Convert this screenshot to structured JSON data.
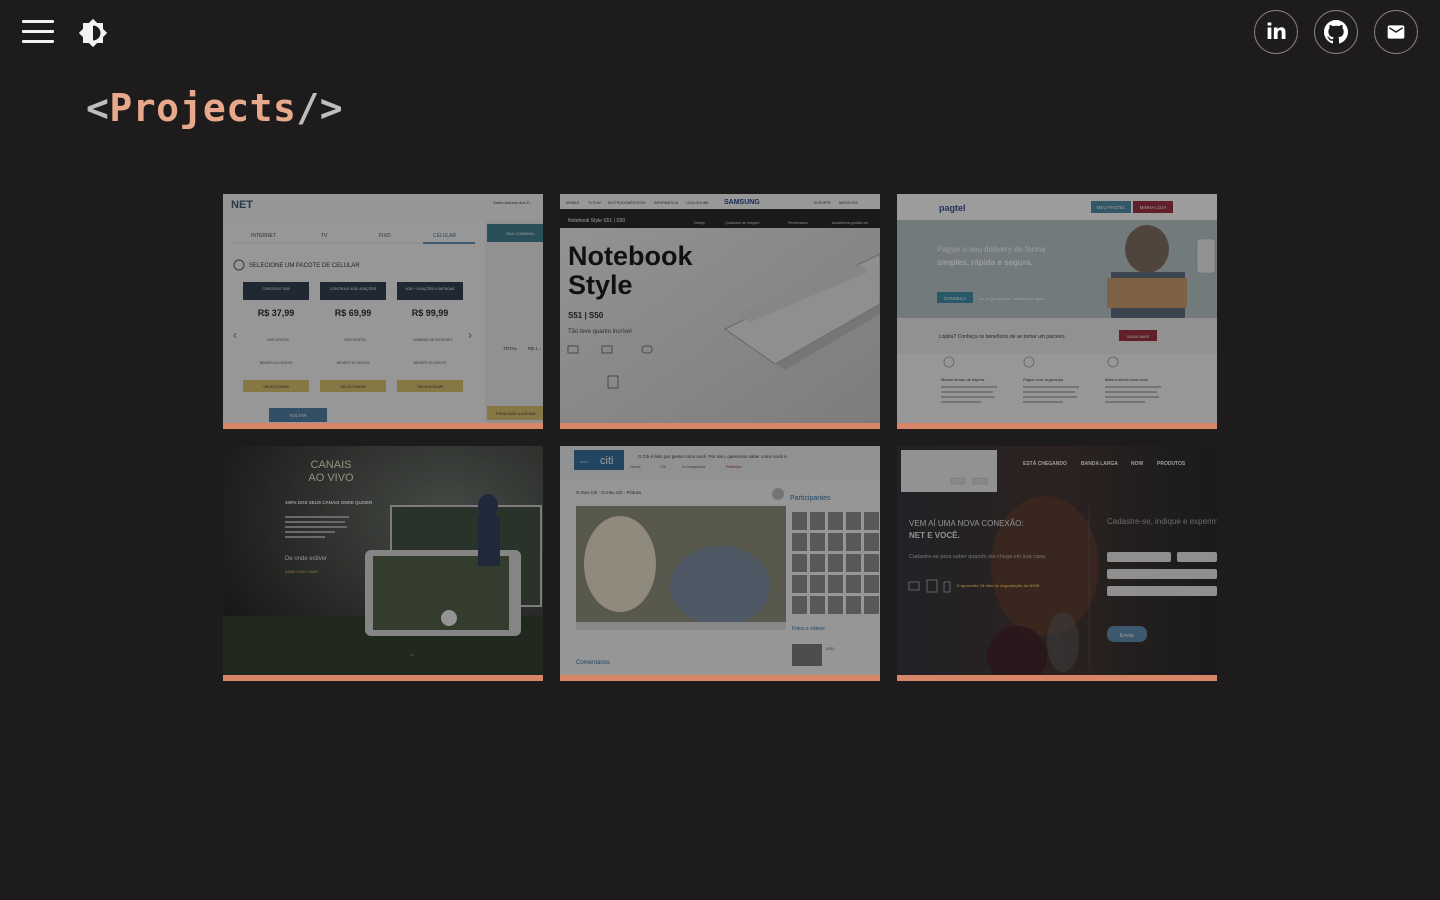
{
  "header": {
    "menu_icon": "hamburger-menu-icon",
    "theme_icon": "brightness-contrast-icon",
    "social": [
      {
        "name": "linkedin",
        "label": "in",
        "icon": "linkedin-icon"
      },
      {
        "name": "github",
        "icon": "github-icon"
      },
      {
        "name": "email",
        "icon": "mail-icon"
      }
    ]
  },
  "page": {
    "title_open": "<",
    "title_text": "Projects",
    "title_close": "/>"
  },
  "colors": {
    "background": "#1e1b1c",
    "accent": "#e7a88c",
    "card_bar": "#d98668"
  },
  "projects": [
    {
      "name": "net-celular",
      "logo": "NET",
      "tabs": [
        "INTERNET",
        "TV",
        "FIXO",
        "CELULAR"
      ],
      "heading": "SELECIONE UM PACOTE DE CELULAR",
      "location": "Santo Antonio dos P...",
      "plans": [
        {
          "name": "CONTROLE 3GB",
          "price": "R$ 37,99",
          "feature": "WIFI GRÁTIS",
          "benefit": "BENEFÍCIO GRÁTIS",
          "action": "SELECIONAR"
        },
        {
          "name": "CONTROLE 4GB LIGAÇÕES",
          "price": "R$ 69,99",
          "feature": "WIFI GRÁTIS",
          "benefit": "BENEFÍCIO GRÁTIS",
          "action": "SELECIONAR"
        },
        {
          "name": "4GB + LIGAÇÕES ILIMITADAS",
          "price": "R$ 99,99",
          "feature": "DOMINIO DE INTERNET",
          "benefit": "BENEFÍCIO GRÁTIS",
          "action": "SELECIONAR"
        }
      ],
      "side_label": "SUA COMBINA...",
      "total_label": "TOTAL",
      "total_value": "R$ 1...",
      "back_button": "VOLTAR",
      "finish_button": "FINALIZAR A ASSINA..."
    },
    {
      "name": "samsung-notebook-style",
      "brand": "SAMSUNG",
      "nav": [
        "MOBILE",
        "TV E AV",
        "ELETRODOMÉSTICOS",
        "INFORMÁTICA",
        "LOJA ONLINE",
        "SUPORTE",
        "NEGÓCIOS"
      ],
      "breadcrumb": "Notebook Style S51 | S50",
      "subnav": [
        "Design",
        "Qualidade de Imagem",
        "Performance",
        "Assistência gratuita em"
      ],
      "title_line1": "Notebook",
      "title_line2": "Style",
      "models": "S51  |  S50",
      "tagline": "Tão leve quanto incrível"
    },
    {
      "name": "pagtel-delivery",
      "logo": "pagtel",
      "top_buttons": [
        "MEU PAGTEL",
        "MINHA LOJA"
      ],
      "headline1": "Pague o seu delivery de forma",
      "headline2": "simples, rápida e segura.",
      "cta": "CONHEÇA",
      "cta_after": "ou, se já conhece, cadastre-se agora.",
      "partner_text": "Lojista? Conheça os benefícios de se tornar um parceiro.",
      "partner_button": "SAIBA MAIS",
      "features": [
        "Menos tempo de espera",
        "Pague com segurança",
        "Mais conforto para você"
      ]
    },
    {
      "name": "canais-ao-vivo",
      "title1": "CANAIS",
      "title2": "AO VIVO",
      "subtitle": "100% DOS SEUS CANAIS ONDE QUISER",
      "text": "De onde estiver",
      "link": "SAIBA COMO USAR"
    },
    {
      "name": "meu-citi",
      "logo": "citi",
      "logo_prefix": "meu",
      "banner": "O Citi é feito por gente como você. Por isso, queremos saber como você é.",
      "nav": [
        "Home",
        "Citi",
        "A Campanha",
        "Participe"
      ],
      "video_title": "O meu Citi - O meu Citi - Pintura",
      "participants_label": "Participantes",
      "photos_label": "Fotos e vídeos",
      "comments_label": "Comentários",
      "year": "2011"
    },
    {
      "name": "net-now",
      "nav": [
        "ESTÁ CHEGANDO",
        "BANDA LARGA",
        "NOW",
        "PRODUTOS"
      ],
      "headline1": "VEM AÍ UMA NOVA CONEXÃO:",
      "headline2": "NET E VOCÊ.",
      "sub": "Cadastre-se para saber quando ela chega em sua casa.",
      "promo": "E aproveite 15 dias de degustação do NOW",
      "form_title": "Cadastre-se, indique e experim...",
      "send_button": "Enviar"
    }
  ]
}
